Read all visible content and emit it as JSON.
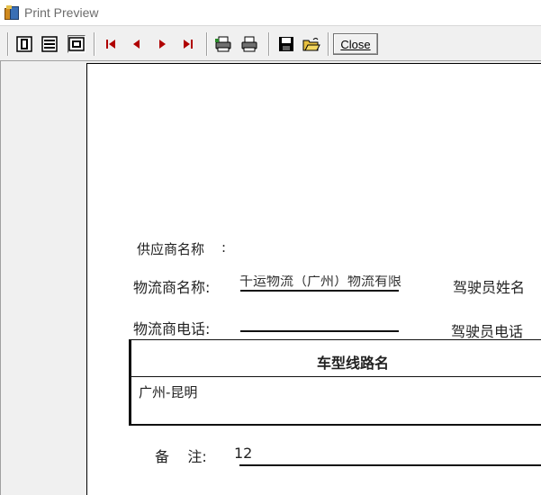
{
  "window": {
    "title": "Print Preview"
  },
  "toolbar": {
    "close_label": "Close",
    "buttons": [
      "one-page-icon",
      "two-pages-icon",
      "fit-page-icon",
      "first-page-icon",
      "prev-page-icon",
      "next-page-icon",
      "last-page-icon",
      "print-setup-icon",
      "print-icon",
      "save-icon",
      "open-icon"
    ]
  },
  "report": {
    "supplier_label": "供应商名称",
    "logistics_name_label": "物流商名称:",
    "logistics_name_value": "千运物流（广州）物流有限",
    "driver_name_label": "驾驶员姓名",
    "logistics_phone_label": "物流商电话:",
    "driver_phone_label": "驾驶员电话",
    "table_header": "车型线路名",
    "table_row": "广州-昆明",
    "remarks_label": "备    注:",
    "remarks_value": "12"
  }
}
